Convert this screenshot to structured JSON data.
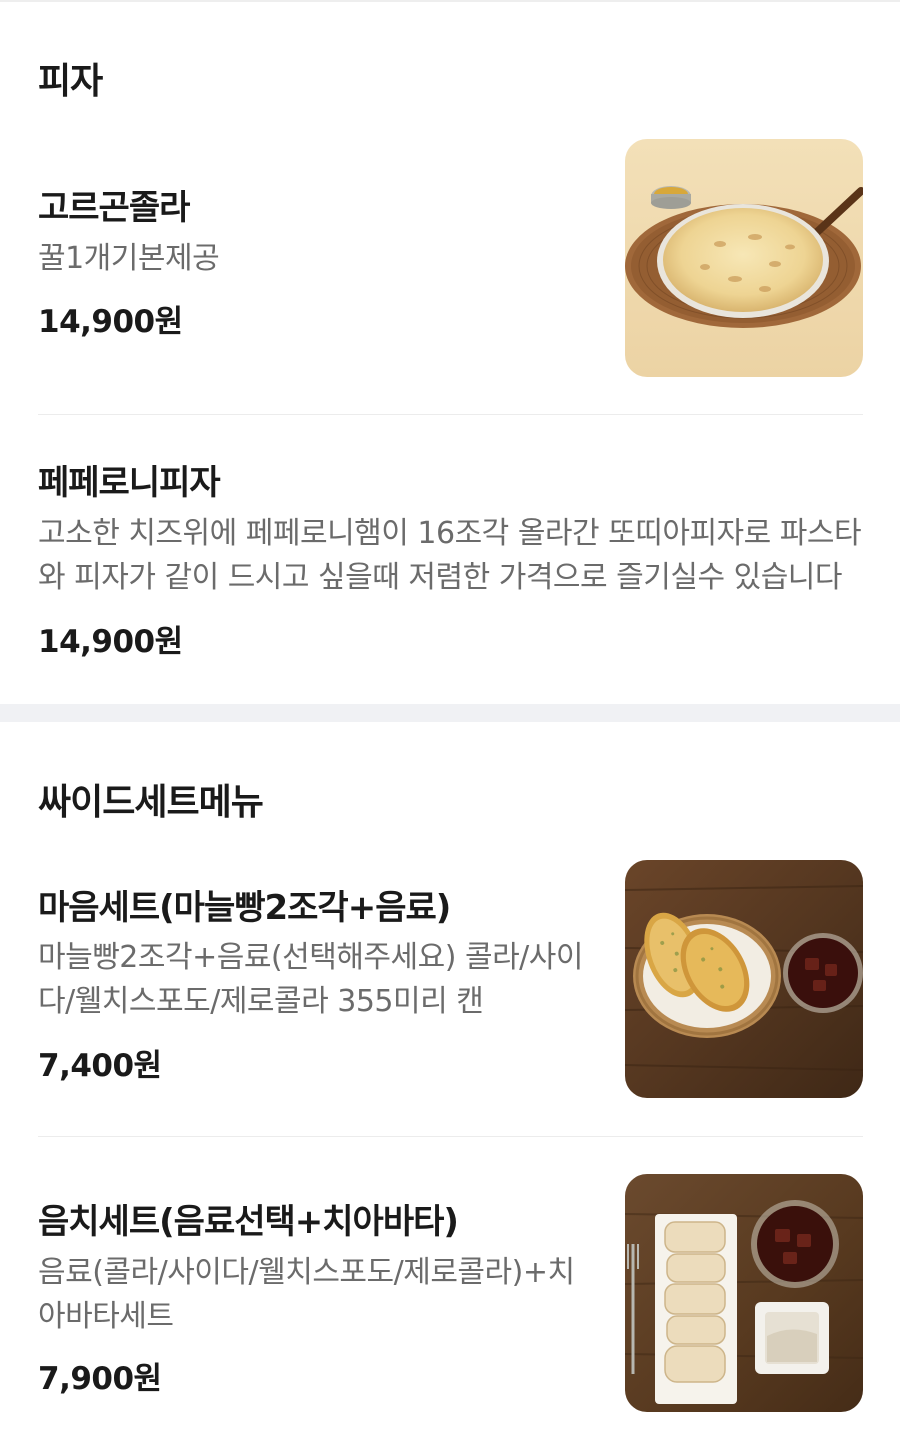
{
  "sections": [
    {
      "title": "피자",
      "items": [
        {
          "name": "고르곤졸라",
          "description": "꿀1개기본제공",
          "price": "14,900원",
          "image_icon": "gorgonzola-pizza-photo"
        },
        {
          "name": "페페로니피자",
          "description": "고소한 치즈위에 페페로니햄이 16조각 올라간 또띠아피자로 파스타와 피자가 같이 드시고 싶을때 저렴한 가격으로 즐기실수 있습니다",
          "price": "14,900원"
        }
      ]
    },
    {
      "title": "싸이드세트메뉴",
      "items": [
        {
          "name": "마음세트(마늘빵2조각+음료)",
          "description": "마늘빵2조각+음료(선택해주세요) 콜라/사이다/웰치스포도/제로콜라 355미리 캔",
          "price": "7,400원",
          "image_icon": "garlic-bread-set-photo"
        },
        {
          "name": "음치세트(음료선택+치아바타)",
          "description": "음료(콜라/사이다/웰치스포도/제로콜라)+치아바타세트",
          "price": "7,900원",
          "image_icon": "ciabatta-set-photo"
        }
      ]
    }
  ],
  "colors": {
    "text_primary": "#1a1a1a",
    "text_secondary": "#6b6b6b",
    "divider": "#ececec",
    "section_gap": "#f0f1f4"
  }
}
